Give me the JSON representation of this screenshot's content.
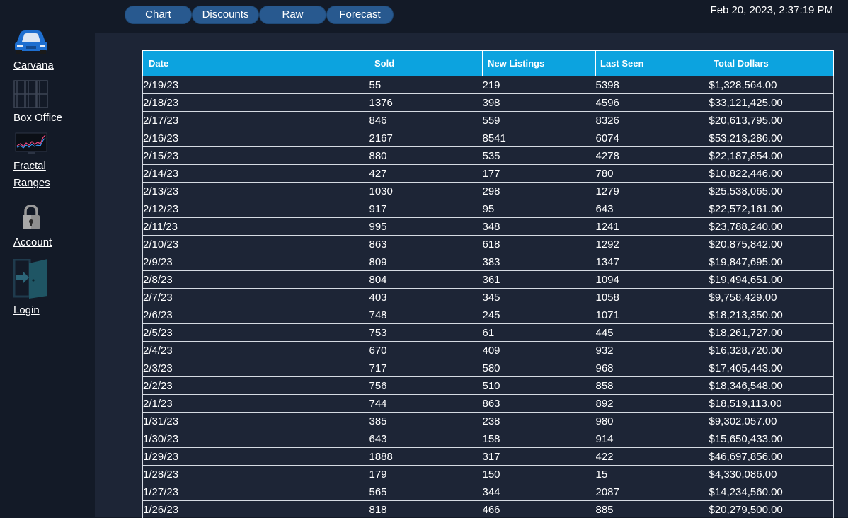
{
  "sidebar": {
    "items": [
      {
        "label": "Carvana",
        "icon": "car-icon"
      },
      {
        "label": "Box Office",
        "icon": "film-strip-icon"
      },
      {
        "label": "Fractal Ranges",
        "icon": "monitor-chart-icon"
      },
      {
        "label": "Account",
        "icon": "lock-icon"
      },
      {
        "label": "Login",
        "icon": "login-door-icon"
      }
    ]
  },
  "tabs": [
    "Chart",
    "Discounts",
    "Raw",
    "Forecast"
  ],
  "datetime": "Feb 20, 2023, 2:37:19 PM",
  "table": {
    "columns": [
      "Date",
      "Sold",
      "New Listings",
      "Last Seen",
      "Total Dollars"
    ],
    "rows": [
      [
        "2/19/23",
        "55",
        "219",
        "5398",
        "$1,328,564.00"
      ],
      [
        "2/18/23",
        "1376",
        "398",
        "4596",
        "$33,121,425.00"
      ],
      [
        "2/17/23",
        "846",
        "559",
        "8326",
        "$20,613,795.00"
      ],
      [
        "2/16/23",
        "2167",
        "8541",
        "6074",
        "$53,213,286.00"
      ],
      [
        "2/15/23",
        "880",
        "535",
        "4278",
        "$22,187,854.00"
      ],
      [
        "2/14/23",
        "427",
        "177",
        "780",
        "$10,822,446.00"
      ],
      [
        "2/13/23",
        "1030",
        "298",
        "1279",
        "$25,538,065.00"
      ],
      [
        "2/12/23",
        "917",
        "95",
        "643",
        "$22,572,161.00"
      ],
      [
        "2/11/23",
        "995",
        "348",
        "1241",
        "$23,788,240.00"
      ],
      [
        "2/10/23",
        "863",
        "618",
        "1292",
        "$20,875,842.00"
      ],
      [
        "2/9/23",
        "809",
        "383",
        "1347",
        "$19,847,695.00"
      ],
      [
        "2/8/23",
        "804",
        "361",
        "1094",
        "$19,494,651.00"
      ],
      [
        "2/7/23",
        "403",
        "345",
        "1058",
        "$9,758,429.00"
      ],
      [
        "2/6/23",
        "748",
        "245",
        "1071",
        "$18,213,350.00"
      ],
      [
        "2/5/23",
        "753",
        "61",
        "445",
        "$18,261,727.00"
      ],
      [
        "2/4/23",
        "670",
        "409",
        "932",
        "$16,328,720.00"
      ],
      [
        "2/3/23",
        "717",
        "580",
        "968",
        "$17,405,443.00"
      ],
      [
        "2/2/23",
        "756",
        "510",
        "858",
        "$18,346,548.00"
      ],
      [
        "2/1/23",
        "744",
        "863",
        "892",
        "$18,519,113.00"
      ],
      [
        "1/31/23",
        "385",
        "238",
        "980",
        "$9,302,057.00"
      ],
      [
        "1/30/23",
        "643",
        "158",
        "914",
        "$15,650,433.00"
      ],
      [
        "1/29/23",
        "1888",
        "317",
        "422",
        "$46,697,856.00"
      ],
      [
        "1/28/23",
        "179",
        "150",
        "15",
        "$4,330,086.00"
      ],
      [
        "1/27/23",
        "565",
        "344",
        "2087",
        "$14,234,560.00"
      ],
      [
        "1/26/23",
        "818",
        "466",
        "885",
        "$20,279,500.00"
      ]
    ]
  },
  "colors": {
    "background": "#131a27",
    "panel": "#1d2536",
    "table_header": "#0ca3df",
    "tab": "#28598f"
  }
}
